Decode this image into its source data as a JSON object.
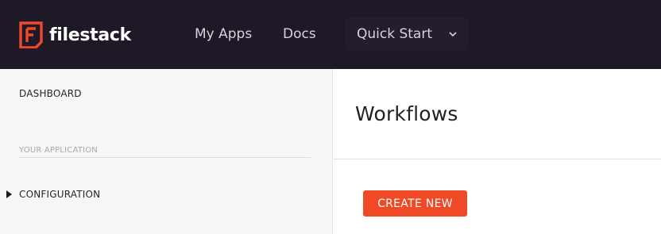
{
  "header": {
    "logo_text": "filestack",
    "nav": {
      "my_apps": "My Apps",
      "docs": "Docs",
      "quick_start": "Quick Start"
    },
    "icons": {
      "logo": "filestack-logo-icon",
      "quick_start_chevron": "chevron-down-icon"
    }
  },
  "sidebar": {
    "dashboard": "DASHBOARD",
    "section_label": "YOUR APPLICATION",
    "configuration": "CONFIGURATION",
    "configuration_icon": "caret-right-icon"
  },
  "main": {
    "title": "Workflows",
    "create_button": "CREATE NEW"
  },
  "colors": {
    "topbar_bg": "#1f1827",
    "accent": "#ef4a25",
    "sidebar_bg": "#f7f7f7"
  }
}
